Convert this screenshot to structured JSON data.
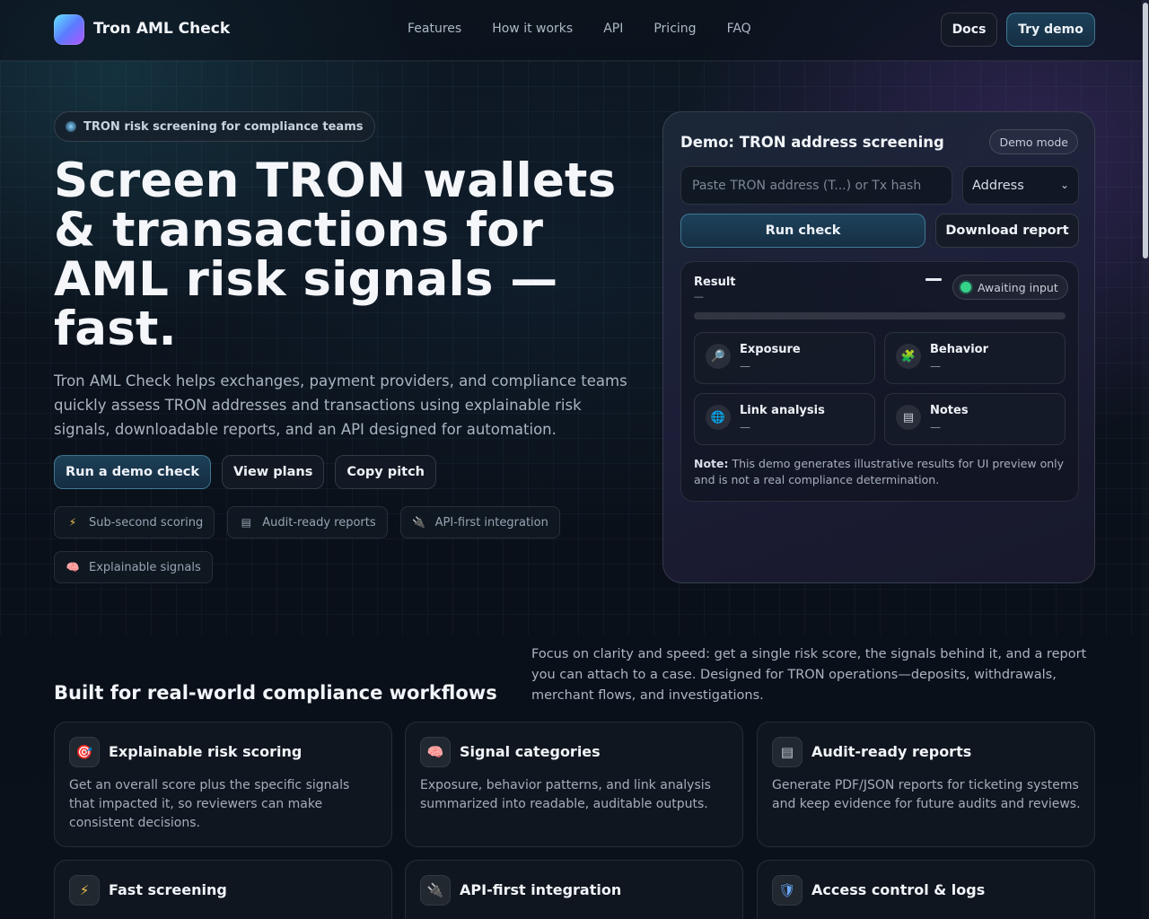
{
  "nav": {
    "brand": "Tron AML Check",
    "links": [
      "Features",
      "How it works",
      "API",
      "Pricing",
      "FAQ"
    ],
    "docs_label": "Docs",
    "try_label": "Try demo"
  },
  "hero": {
    "badge": "TRON risk screening for compliance teams",
    "title": "Screen TRON wallets & transactions for AML risk signals — fast.",
    "subtitle": "Tron AML Check helps exchanges, payment providers, and compliance teams quickly assess TRON addresses and transactions using explainable risk signals, downloadable reports, and an API designed for automation.",
    "cta_demo": "Run a demo check",
    "cta_plans": "View plans",
    "cta_pitch": "Copy pitch",
    "chips": [
      {
        "icon": "lightning-icon",
        "glyph": "⚡",
        "label": "Sub-second scoring"
      },
      {
        "icon": "document-icon",
        "glyph": "▤",
        "label": "Audit-ready reports"
      },
      {
        "icon": "plug-icon",
        "glyph": "🔌",
        "label": "API-first integration"
      },
      {
        "icon": "brain-icon",
        "glyph": "🧠",
        "label": "Explainable signals"
      }
    ]
  },
  "demo": {
    "title": "Demo: TRON address screening",
    "mode_badge": "Demo mode",
    "input_placeholder": "Paste TRON address (T...) or Tx hash",
    "input_value": "",
    "type_selected": "Address",
    "run_label": "Run check",
    "download_label": "Download report",
    "result": {
      "label": "Result",
      "sub": "—",
      "score": "",
      "status": "Awaiting input",
      "progress_percent": 0
    },
    "tiles": [
      {
        "icon": "magnifier-icon",
        "glyph": "🔎",
        "name": "Exposure",
        "value": "—"
      },
      {
        "icon": "puzzle-icon",
        "glyph": "🧩",
        "name": "Behavior",
        "value": "—"
      },
      {
        "icon": "globe-icon",
        "glyph": "🌐",
        "name": "Link analysis",
        "value": "—"
      },
      {
        "icon": "notes-icon",
        "glyph": "▤",
        "name": "Notes",
        "value": "—"
      }
    ],
    "note_bold": "Note:",
    "note_text": " This demo generates illustrative results for UI preview only and is not a real compliance determination."
  },
  "section": {
    "title": "Built for real-world compliance workflows",
    "description": "Focus on clarity and speed: get a single risk score, the signals behind it, and a report you can attach to a case. Designed for TRON operations—deposits, withdrawals, merchant flows, and investigations.",
    "cards": [
      {
        "icon": "target-icon",
        "glyph": "🎯",
        "title": "Explainable risk scoring",
        "desc": "Get an overall score plus the specific signals that impacted it, so reviewers can make consistent decisions."
      },
      {
        "icon": "brain-icon",
        "glyph": "🧠",
        "title": "Signal categories",
        "desc": "Exposure, behavior patterns, and link analysis summarized into readable, auditable outputs."
      },
      {
        "icon": "document-icon",
        "glyph": "▤",
        "title": "Audit-ready reports",
        "desc": "Generate PDF/JSON reports for ticketing systems and keep evidence for future audits and reviews."
      },
      {
        "icon": "lightning-icon",
        "glyph": "⚡",
        "title": "Fast screening",
        "desc": ""
      },
      {
        "icon": "plug-icon",
        "glyph": "🔌",
        "title": "API-first integration",
        "desc": ""
      },
      {
        "icon": "shield-icon",
        "glyph": "🛡",
        "title": "Access control & logs",
        "desc": ""
      }
    ]
  }
}
